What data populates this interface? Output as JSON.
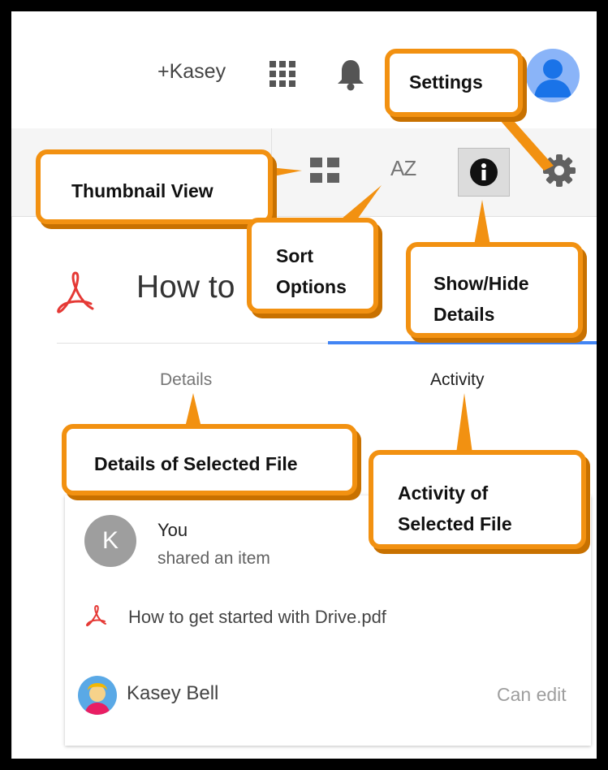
{
  "topbar": {
    "user_link": "+Kasey",
    "icons": [
      "apps-grid-icon",
      "notifications-bell-icon",
      "account-avatar-icon"
    ]
  },
  "toolbar": {
    "icons": [
      "thumbnail-view-icon",
      "sort-az-icon",
      "info-icon",
      "settings-gear-icon"
    ],
    "sort_label": "AZ"
  },
  "details_panel": {
    "file_title_visible": "How to",
    "tabs": [
      {
        "label": "Details",
        "active": false
      },
      {
        "label": "Activity",
        "active": true
      }
    ]
  },
  "activity_card": {
    "avatar_letter": "K",
    "actor": "You",
    "action": "shared an item",
    "file_name": "How to get started with Drive.pdf",
    "shared_with_name": "Kasey Bell",
    "permission": "Can edit"
  },
  "callouts": {
    "settings": "Settings",
    "thumbnail_view": "Thumbnail View",
    "sort_line1": "Sort",
    "sort_line2": "Options",
    "show_line1": "Show/Hide",
    "show_line2": "Details",
    "details_of_selected": "Details of Selected File",
    "activity_line1": "Activity of",
    "activity_line2": "Selected File"
  },
  "colors": {
    "callout_border": "#f29111",
    "callout_shadow": "#c87100",
    "tab_active": "#4285f4",
    "pdf_red": "#e53935"
  }
}
